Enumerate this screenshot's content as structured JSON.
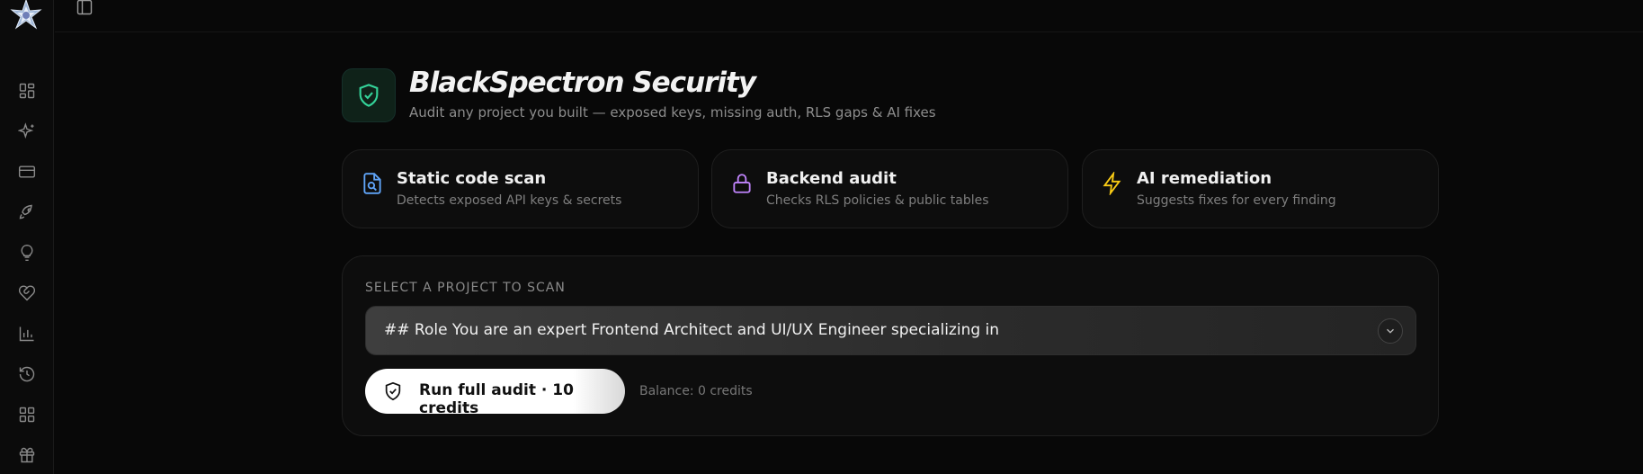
{
  "sidebar": {
    "items": [
      {
        "icon": "dashboard-icon"
      },
      {
        "icon": "sparkles-icon"
      },
      {
        "icon": "credit-card-icon"
      },
      {
        "icon": "rocket-icon"
      },
      {
        "icon": "lightbulb-icon"
      },
      {
        "icon": "heart-handshake-icon"
      },
      {
        "icon": "bar-chart-icon"
      },
      {
        "icon": "history-icon"
      },
      {
        "icon": "apps-grid-icon"
      },
      {
        "icon": "gift-icon"
      }
    ]
  },
  "header": {
    "title": "BlackSpectron Security",
    "subtitle": "Audit any project you built — exposed keys, missing auth, RLS gaps & AI fixes",
    "icon": "shield-check-icon",
    "accent": "#34d399"
  },
  "features": [
    {
      "title": "Static code scan",
      "desc": "Detects exposed API keys & secrets",
      "icon": "file-search-icon",
      "color": "#60a5fa"
    },
    {
      "title": "Backend audit",
      "desc": "Checks RLS policies & public tables",
      "icon": "lock-icon",
      "color": "#c084fc"
    },
    {
      "title": "AI remediation",
      "desc": "Suggests fixes for every finding",
      "icon": "lightning-icon",
      "color": "#facc15"
    }
  ],
  "scan": {
    "label": "SELECT A PROJECT TO SCAN",
    "selected_project": "## Role You are an expert Frontend Architect and UI/UX Engineer specializing in",
    "run_label": "Run full audit · 10 credits",
    "balance": "Balance: 0 credits"
  }
}
